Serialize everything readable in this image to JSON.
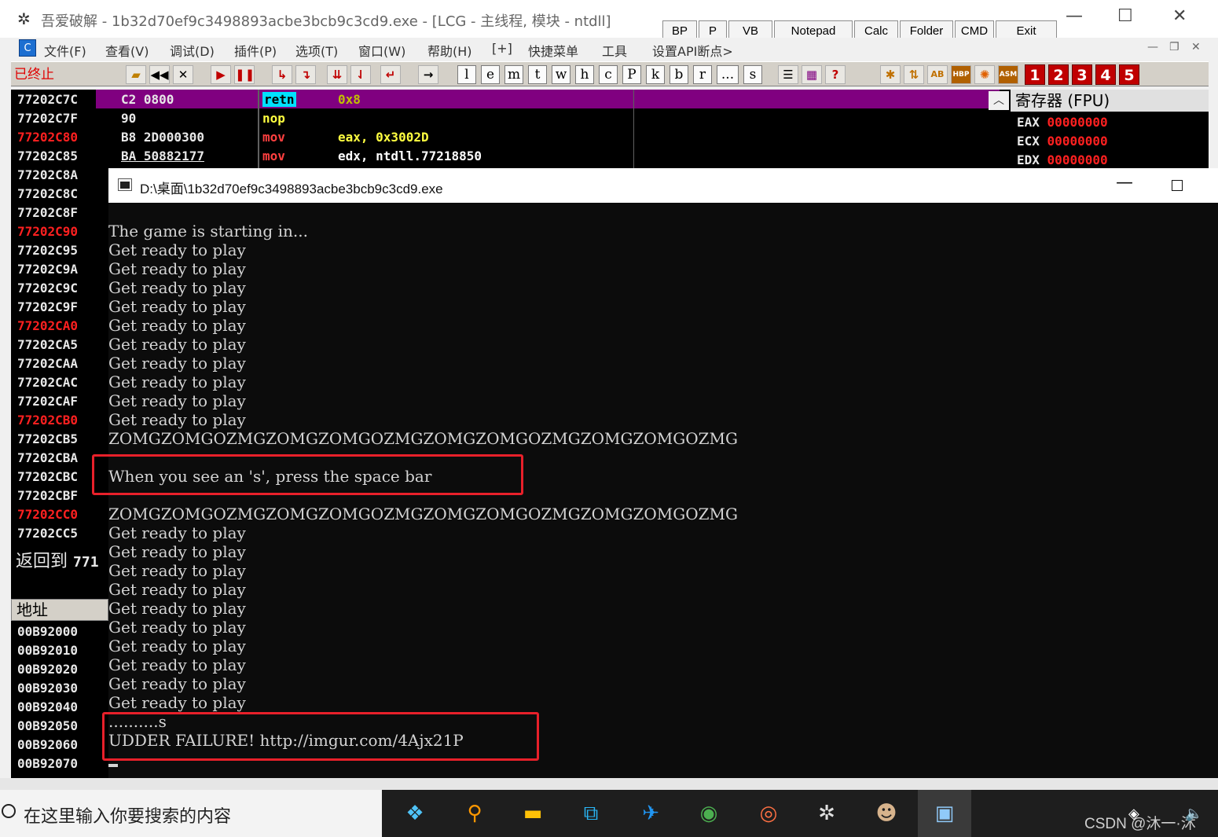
{
  "olly": {
    "title": "吾爱破解 - 1b32d70ef9c3498893acbe3bcb9c3cd9.exe - [LCG - 主线程, 模块 - ntdll]",
    "tool_buttons": [
      "BP",
      "P",
      "VB",
      "Notepad",
      "Calc",
      "Folder",
      "CMD",
      "Exit"
    ],
    "menu": [
      "文件(F)",
      "查看(V)",
      "调试(D)",
      "插件(P)",
      "选项(T)",
      "窗口(W)",
      "帮助(H)",
      "[+]",
      "快捷菜单",
      "工具",
      "设置API断点>"
    ],
    "status": "已终止",
    "toolbar_letters": [
      "l",
      "e",
      "m",
      "t",
      "w",
      "h",
      "c",
      "P",
      "k",
      "b",
      "r",
      "...",
      "s"
    ],
    "toolbar_numbers": [
      "1",
      "2",
      "3",
      "4",
      "5"
    ],
    "addresses": [
      {
        "addr": "77202C7C",
        "red": false
      },
      {
        "addr": "77202C7F",
        "red": false
      },
      {
        "addr": "77202C80",
        "red": true
      },
      {
        "addr": "77202C85",
        "red": false
      },
      {
        "addr": "77202C8A",
        "red": false
      },
      {
        "addr": "77202C8C",
        "red": false
      },
      {
        "addr": "77202C8F",
        "red": false
      },
      {
        "addr": "77202C90",
        "red": true
      },
      {
        "addr": "77202C95",
        "red": false
      },
      {
        "addr": "77202C9A",
        "red": false
      },
      {
        "addr": "77202C9C",
        "red": false
      },
      {
        "addr": "77202C9F",
        "red": false
      },
      {
        "addr": "77202CA0",
        "red": true
      },
      {
        "addr": "77202CA5",
        "red": false
      },
      {
        "addr": "77202CAA",
        "red": false
      },
      {
        "addr": "77202CAC",
        "red": false
      },
      {
        "addr": "77202CAF",
        "red": false
      },
      {
        "addr": "77202CB0",
        "red": true
      },
      {
        "addr": "77202CB5",
        "red": false
      },
      {
        "addr": "77202CBA",
        "red": false
      },
      {
        "addr": "77202CBC",
        "red": false
      },
      {
        "addr": "77202CBF",
        "red": false
      },
      {
        "addr": "77202CC0",
        "red": true
      },
      {
        "addr": "77202CC5",
        "red": false
      }
    ],
    "disasm": [
      {
        "hex": "C2 0800",
        "mnemonic": "retn",
        "operand": "0x8"
      },
      {
        "hex": "90",
        "mnemonic": "nop",
        "operand": ""
      },
      {
        "hex": "B8 2D000300",
        "mnemonic": "mov",
        "operand": "eax, 0x3002D"
      },
      {
        "hex": "BA 50882177",
        "mnemonic": "mov",
        "operand": "edx, ntdll.77218850"
      }
    ],
    "registers_title": "寄存器 (FPU)",
    "registers": [
      {
        "name": "EAX",
        "value": "00000000"
      },
      {
        "name": "ECX",
        "value": "00000000"
      },
      {
        "name": "EDX",
        "value": "00000000"
      }
    ],
    "return_label": "返回到",
    "return_addr": "771",
    "dump_header": "地址",
    "dump_rows": [
      "00B92000",
      "00B92010",
      "00B92020",
      "00B92030",
      "00B92040",
      "00B92050",
      "00B92060",
      "00B92070"
    ]
  },
  "console": {
    "title": "D:\\桌面\\1b32d70ef9c3498893acbe3bcb9c3cd9.exe",
    "lines": [
      "The game is starting in...",
      "Get ready to play",
      "Get ready to play",
      "Get ready to play",
      "Get ready to play",
      "Get ready to play",
      "Get ready to play",
      "Get ready to play",
      "Get ready to play",
      "Get ready to play",
      "Get ready to play",
      "ZOMGZOMGOZMGZOMGZOMGOZMGZOMGZOMGOZMGZOMGZOMGOZMG",
      "",
      "When you see an 's', press the space bar",
      "",
      "ZOMGZOMGOZMGZOMGZOMGOZMGZOMGZOMGOZMGZOMGZOMGOZMG",
      "Get ready to play",
      "Get ready to play",
      "Get ready to play",
      "Get ready to play",
      "Get ready to play",
      "Get ready to play",
      "Get ready to play",
      "Get ready to play",
      "Get ready to play",
      "Get ready to play",
      "..........s",
      "UDDER FAILURE! http://imgur.com/4Ajx21P"
    ]
  },
  "taskbar": {
    "search_placeholder": "在这里输入你要搜索的内容",
    "tray_text": "CSDN @沐一·沐"
  }
}
